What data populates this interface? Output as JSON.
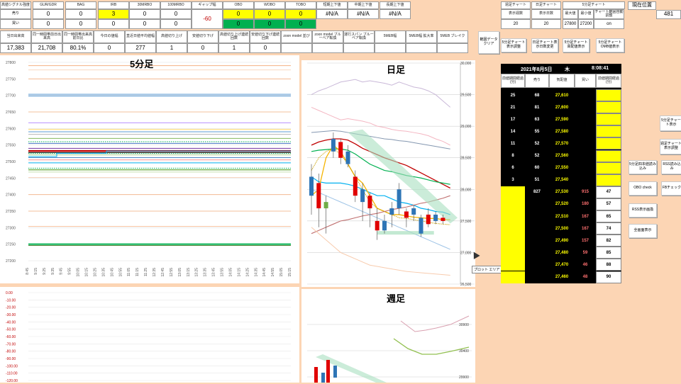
{
  "top": {
    "headers": [
      "高値シグナル強度",
      "GUR/GDR",
      "BAG",
      "IRB",
      "30MRBO",
      "100MRBO",
      "ギャップ幅",
      "OBO",
      "WOBO",
      "TOBO",
      "短期上下値",
      "中期上下値",
      "長期上下値"
    ],
    "row_sell_label": "売り",
    "row_buy_label": "買い",
    "sell": [
      "0",
      "0",
      "3",
      "0",
      "0"
    ],
    "buy": [
      "0",
      "0",
      "0",
      "0",
      "0"
    ],
    "gap": "-60",
    "obo_sell": [
      "0",
      "0",
      "0"
    ],
    "obo_buy": [
      "0",
      "0",
      "0"
    ],
    "na": [
      "#N/A",
      "#N/A",
      "#N/A"
    ]
  },
  "chart_info": {
    "headers": [
      "週足チャート",
      "日足チャート",
      "5分足チャート"
    ],
    "sub_headers": [
      "表示週数",
      "表示日数",
      "最大値",
      "最小値",
      "チャート範囲自動調整"
    ],
    "values": [
      "20",
      "20",
      "27800",
      "27200",
      "on"
    ]
  },
  "position": {
    "label": "現在位置",
    "value": "481"
  },
  "stats": {
    "headers": [
      "当日出来高",
      "同一時間帯前日出来高",
      "同一時間帯出来高前日比",
      "今日の値幅",
      "直近日値平均値幅",
      "高値切り上げ",
      "安値切り下げ",
      "高値切り上げ連続回数",
      "安値切り下げ連続回数",
      "zoon model 並び",
      "zoon model ブルーベア転換",
      "運行スパン ブルーベア転換",
      "5MEB幅",
      "5MEB幅 拡大率",
      "5MEB ブレイク"
    ],
    "values": [
      "17,383",
      "21,708",
      "80.1%",
      "0",
      "277",
      "1",
      "0",
      "1",
      "0",
      "",
      "",
      "",
      "",
      "",
      ""
    ]
  },
  "buttons": {
    "day_clear": "範囲データクリア",
    "five_display": "5分足チャート表示調整",
    "day_change": "日足チャート表示日数変更",
    "five_high": "5分足チャート高配値表示",
    "five_omb": "5分足チャートOMB値表示",
    "side": [
      "5分足チャート表示",
      "週足チャート表示調整",
      "5分足四本値読み込み",
      "RSS読み込み",
      "OBO check",
      "FBチェック",
      "RSS表示画換",
      "全画面表示"
    ],
    "plot_area": "プロット エリア"
  },
  "panels": {
    "five_min": "5分足",
    "daily": "日足",
    "weekly": "週足"
  },
  "five_yaxis": [
    "27800",
    "27750",
    "27700",
    "27650",
    "27600",
    "27550",
    "27500",
    "27450",
    "27400",
    "27350",
    "27300",
    "27250",
    "27200"
  ],
  "five_xaxis": [
    "8:45",
    "9:15",
    "9:25",
    "9:35",
    "9:45",
    "9:55",
    "10:05",
    "10:15",
    "10:25",
    "10:35",
    "10:45",
    "10:55",
    "11:05",
    "11:15",
    "11:25",
    "12:35",
    "12:45",
    "12:55",
    "13:05",
    "13:15",
    "13:25",
    "13:35",
    "13:45",
    "13:55",
    "14:05",
    "14:15",
    "14:25",
    "14:35",
    "14:45",
    "14:55",
    "15:05",
    "15:15"
  ],
  "lower_yaxis": [
    "0.00",
    "-10.00",
    "-20.00",
    "-30.00",
    "-40.00",
    "-50.00",
    "-60.00",
    "-70.00",
    "-80.00",
    "-90.00",
    "-100.00",
    "-110.00",
    "-120.00"
  ],
  "daily_yaxis": [
    "30,000",
    "29,500",
    "29,000",
    "28,500",
    "28,000",
    "27,500",
    "27,000",
    "26,500"
  ],
  "weekly_yaxis": [
    "30900",
    "30400",
    "29900"
  ],
  "board": {
    "date": "2021年8月5日",
    "weekday": "木",
    "time": "8:08:41",
    "headers": [
      "前値期間経過(分)",
      "売り",
      "気配値",
      "買い",
      "前値期間経過(分)"
    ],
    "rows": [
      {
        "t": "25",
        "sell": "68",
        "price": "27,610",
        "buy": "",
        "t2": ""
      },
      {
        "t": "21",
        "sell": "81",
        "price": "27,600",
        "buy": "",
        "t2": ""
      },
      {
        "t": "17",
        "sell": "63",
        "price": "27,590",
        "buy": "",
        "t2": ""
      },
      {
        "t": "14",
        "sell": "55",
        "price": "27,580",
        "buy": "",
        "t2": ""
      },
      {
        "t": "11",
        "sell": "52",
        "price": "27,570",
        "buy": "",
        "t2": ""
      },
      {
        "t": "8",
        "sell": "52",
        "price": "27,560",
        "buy": "",
        "t2": ""
      },
      {
        "t": "6",
        "sell": "60",
        "price": "27,550",
        "buy": "",
        "t2": ""
      },
      {
        "t": "3",
        "sell": "51",
        "price": "27,540",
        "buy": "",
        "t2": ""
      },
      {
        "t": "",
        "sell": "827",
        "price": "27,530",
        "buy": "915",
        "t2": "47"
      },
      {
        "t": "",
        "sell": "",
        "price": "27,520",
        "buy": "180",
        "t2": "57"
      },
      {
        "t": "",
        "sell": "",
        "price": "27,510",
        "buy": "167",
        "t2": "65"
      },
      {
        "t": "",
        "sell": "",
        "price": "27,500",
        "buy": "167",
        "t2": "74"
      },
      {
        "t": "",
        "sell": "",
        "price": "27,490",
        "buy": "157",
        "t2": "82"
      },
      {
        "t": "",
        "sell": "",
        "price": "27,480",
        "buy": "59",
        "t2": "85"
      },
      {
        "t": "",
        "sell": "",
        "price": "27,470",
        "buy": "46",
        "t2": "88"
      },
      {
        "t": "",
        "sell": "",
        "price": "27,460",
        "buy": "48",
        "t2": "90"
      }
    ]
  },
  "colors": {
    "yellow": "#ffff00",
    "green": "#00b050",
    "bg": "#fcd5b4",
    "sell": "#ffffff",
    "price": "#ffff00"
  }
}
